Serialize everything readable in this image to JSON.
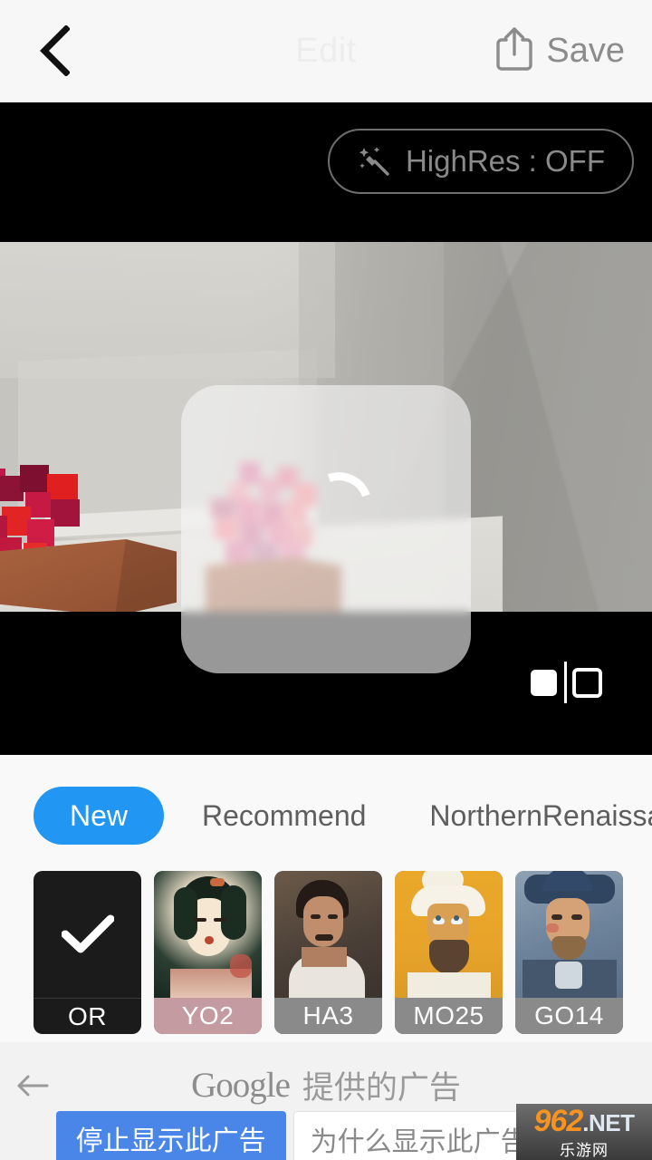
{
  "header": {
    "title": "Edit",
    "back_icon": "chevron-left-icon",
    "share_icon": "share-icon",
    "save_label": "Save"
  },
  "canvas": {
    "highres": {
      "label": "HighRes : OFF",
      "icon": "magic-wand-sparkle-icon",
      "state": "OFF"
    },
    "processing": {
      "spinner_icon": "loading-spinner-icon",
      "overlay": "frosted-processing-overlay"
    },
    "compare_toggle_icon": "before-after-compare-icon",
    "preview_description": "pixel-art voxel scene with red and pink flowers in wooden pots"
  },
  "panel": {
    "tabs": [
      {
        "label": "New",
        "active": true
      },
      {
        "label": "Recommend",
        "active": false
      },
      {
        "label": "NorthernRenaissan",
        "active": false
      }
    ],
    "styles": [
      {
        "code": "OR",
        "selected": true,
        "label_color": "#1b1b1b",
        "icon": "check-icon"
      },
      {
        "code": "YO2",
        "selected": false,
        "label_color": "#c49ba0"
      },
      {
        "code": "HA3",
        "selected": false,
        "label_color": "#8a8a8a"
      },
      {
        "code": "MO25",
        "selected": false,
        "label_color": "#8a8a8a"
      },
      {
        "code": "GO14",
        "selected": false,
        "label_color": "#8a8a8a"
      }
    ]
  },
  "ad": {
    "back_icon": "arrow-left-icon",
    "provider": "Google",
    "provider_suffix": "提供的广告",
    "stop_label": "停止显示此广告",
    "why_label": "为什么显示此广告?",
    "info_icon": "info-circle-icon",
    "watermark": {
      "number": "962",
      "domain": ".NET",
      "chinese": "乐游网"
    }
  },
  "colors": {
    "accent_blue": "#2196f3",
    "ad_blue": "#4a86e8",
    "header_bg": "#f7f7f7",
    "panel_bg": "#f9f9f9",
    "canvas_bg": "#000000"
  }
}
